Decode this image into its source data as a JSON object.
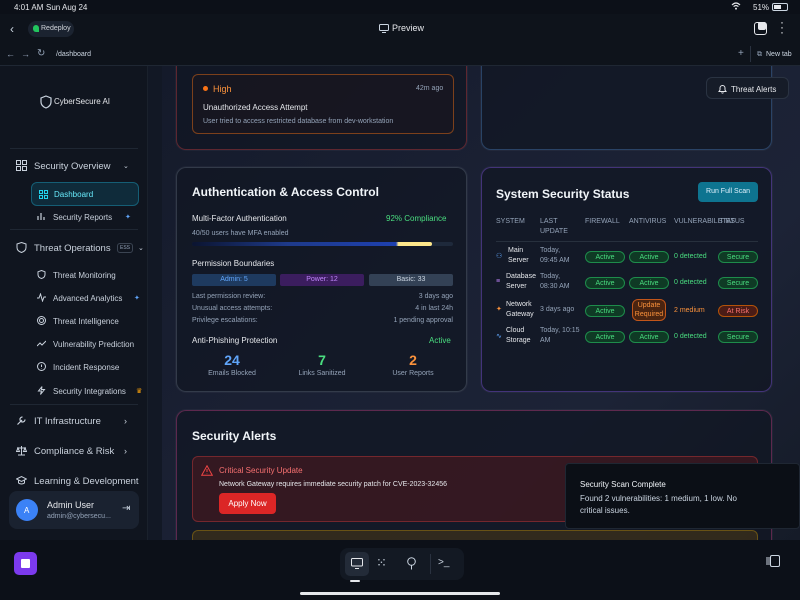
{
  "status_bar": {
    "time": "4:01 AM",
    "date": "Sun Aug 24",
    "battery": "51%"
  },
  "topbar": {
    "project": "Redeploy",
    "preview": "Preview"
  },
  "urlbar": {
    "path": "/dashboard",
    "new_tab": "New tab"
  },
  "sidebar": {
    "brand": "CyberSecure AI",
    "sections": {
      "security_overview": "Security Overview",
      "dashboard": "Dashboard",
      "security_reports": "Security Reports",
      "threat_operations": "Threat Operations",
      "threat_badge": "ESS",
      "threat_monitoring": "Threat Monitoring",
      "advanced_analytics": "Advanced Analytics",
      "threat_intelligence": "Threat Intelligence",
      "vulnerability_prediction": "Vulnerability Prediction",
      "incident_response": "Incident Response",
      "security_integrations": "Security Integrations",
      "it_infrastructure": "IT Infrastructure",
      "compliance_risk": "Compliance & Risk",
      "learning_development": "Learning & Development"
    },
    "user": {
      "initial": "A",
      "name": "Admin User",
      "email": "admin@cybersecu..."
    }
  },
  "threat_alerts_button": "Threat Alerts",
  "top_alert": {
    "severity": "High",
    "time": "42m ago",
    "title": "Unauthorized Access Attempt",
    "desc": "User tried to access restricted database from dev-workstation"
  },
  "auth": {
    "title": "Authentication & Access Control",
    "mfa_label": "Multi-Factor Authentication",
    "mfa_compliance": "92% Compliance",
    "mfa_users": "40/50 users have MFA enabled",
    "mfa_progress": 0.92,
    "perm_title": "Permission Boundaries",
    "perm_admin": "Admin: 5",
    "perm_power": "Power: 12",
    "perm_basic": "Basic: 33",
    "rows": [
      {
        "label": "Last permission review:",
        "value": "3 days ago"
      },
      {
        "label": "Unusual access attempts:",
        "value": "4 in last 24h"
      },
      {
        "label": "Privilege escalations:",
        "value": "1 pending approval"
      }
    ],
    "phish_title": "Anti-Phishing Protection",
    "phish_status": "Active",
    "stats": [
      {
        "value": "24",
        "label": "Emails Blocked"
      },
      {
        "value": "7",
        "label": "Links Sanitized"
      },
      {
        "value": "2",
        "label": "User Reports"
      }
    ]
  },
  "system": {
    "title": "System Security Status",
    "scan_button": "Run Full Scan",
    "headers": {
      "system": "SYSTEM",
      "last_update_1": "LAST",
      "last_update_2": "UPDATE",
      "firewall": "FIREWALL",
      "antivirus": "ANTIVIRUS",
      "vulnerabilities": "VULNERABILITIES",
      "status": "STATUS"
    },
    "rows": [
      {
        "name1": "Main",
        "name2": "Server",
        "upd1": "Today,",
        "upd2": "09:45 AM",
        "firewall": "Active",
        "antivirus": "Active",
        "vuln": "0 detected",
        "status": "Secure"
      },
      {
        "name1": "Database",
        "name2": "Server",
        "upd1": "Today,",
        "upd2": "08:30 AM",
        "firewall": "Active",
        "antivirus": "Active",
        "vuln": "0 detected",
        "status": "Secure"
      },
      {
        "name1": "Network",
        "name2": "Gateway",
        "upd1": "3 days ago",
        "upd2": "",
        "firewall": "Active",
        "antivirus": "Update Required",
        "vuln": "2 medium",
        "status": "At Risk"
      },
      {
        "name1": "Cloud",
        "name2": "Storage",
        "upd1": "Today, 10:15",
        "upd2": "AM",
        "firewall": "Active",
        "antivirus": "Active",
        "vuln": "0 detected",
        "status": "Secure"
      }
    ]
  },
  "alerts": {
    "title": "Security Alerts",
    "critical_title": "Critical Security Update",
    "critical_desc": "Network Gateway requires immediate security patch for CVE-2023-32456",
    "apply_button": "Apply Now"
  },
  "toast": {
    "title": "Security Scan Complete",
    "body1": "Found 2 vulnerabilities: 1 medium, 1 low. No",
    "body2": "critical issues."
  },
  "colors": {
    "accent": "#22d3ee",
    "green": "#4ade80",
    "orange": "#fb923c",
    "red": "#ef4444",
    "purple": "#8b5cf6"
  }
}
